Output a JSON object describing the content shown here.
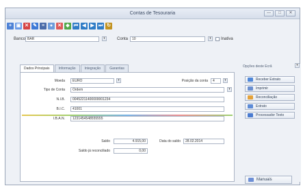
{
  "window": {
    "title": "Contas de Tesouraria",
    "buttons": [
      "—",
      "□",
      "✕"
    ]
  },
  "toolbar": {
    "icons": [
      {
        "name": "new-icon",
        "glyph": "+",
        "color": "#4e82d6"
      },
      {
        "name": "save-icon",
        "glyph": "▣",
        "color": "#6b9be8"
      },
      {
        "name": "delete-icon",
        "glyph": "✕",
        "color": "#d64545"
      },
      {
        "name": "edit-icon",
        "glyph": "✎",
        "color": "#3f7ad6"
      },
      {
        "name": "list-icon",
        "glyph": "≡",
        "color": "#4b6ca9"
      },
      {
        "name": "user-icon",
        "glyph": "●",
        "color": "#6d9cdc"
      },
      {
        "name": "close-icon",
        "glyph": "✕",
        "color": "#dd5a5a"
      },
      {
        "name": "filter-icon",
        "glyph": "◆",
        "color": "#52a84a"
      },
      {
        "name": "nav-first-icon",
        "glyph": "⏮",
        "color": "#2f7cc6"
      },
      {
        "name": "nav-prev-icon",
        "glyph": "◀",
        "color": "#2f7cc6"
      },
      {
        "name": "nav-next-icon",
        "glyph": "▶",
        "color": "#2f7cc6"
      },
      {
        "name": "nav-last-icon",
        "glyph": "⏭",
        "color": "#2f7cc6"
      },
      {
        "name": "export-icon",
        "glyph": "↻",
        "color": "#c29321"
      }
    ]
  },
  "form": {
    "banco_label": "Banco",
    "banco_value": "BAR",
    "conta_label": "Conta",
    "conta_value": "10",
    "inativa_label": "Inativa"
  },
  "tabs": [
    "Dados Principais",
    "Informação",
    "Integração",
    "Garantias"
  ],
  "details": {
    "moeda_label": "Moeda",
    "moeda_value": "EURO",
    "posicao_label": "Posição da conta",
    "posicao_value": "4",
    "tipo_label": "Tipo de Conta",
    "tipo_value": "Ordem",
    "nib_label": "N.I.B.",
    "nib_value": "00452211400000001234",
    "bic_label": "B.I.C.",
    "bic_value": "41001",
    "iban_label": "I.B.A.N.",
    "iban_value": "1231454548555555",
    "saldo_label": "Saldo",
    "saldo_value": "4.915,00",
    "data_saldo_label": "Data do saldo",
    "data_saldo_value": "28.02.2014",
    "saldo_reconciliado_label": "Saldo já reconciliado",
    "saldo_reconciliado_value": "0,00"
  },
  "side": {
    "header": "Opções deste Ecrã",
    "buttons": [
      {
        "label": "Receber Extrato",
        "color": "#4f87d8"
      },
      {
        "label": "Imprimir",
        "color": "#6a8fcf"
      },
      {
        "label": "Reconciliação",
        "color": "#e4a23b"
      },
      {
        "label": "Extrato",
        "color": "#5d8bd6"
      },
      {
        "label": "Processador Texto",
        "color": "#4a7bd0"
      }
    ],
    "bottom_button": "Manuais"
  }
}
